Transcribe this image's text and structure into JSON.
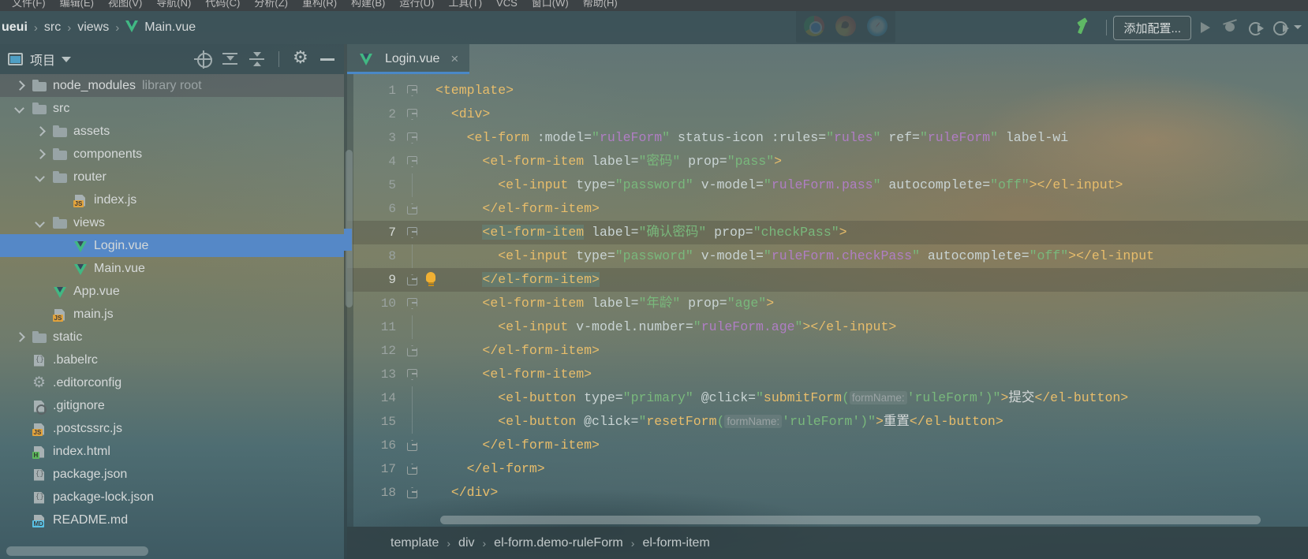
{
  "menubar": {
    "items": [
      "文件(F)",
      "编辑(E)",
      "视图(V)",
      "导航(N)",
      "代码(C)",
      "分析(Z)",
      "重构(R)",
      "构建(B)",
      "运行(U)",
      "工具(T)",
      "VCS",
      "窗口(W)",
      "帮助(H)"
    ]
  },
  "navbar": {
    "crumbs": [
      "ueui",
      "src",
      "views",
      "Main.vue"
    ],
    "separator": "›",
    "add_configuration_label": "添加配置...",
    "icons": [
      "hammer-build-icon",
      "run-icon",
      "debug-icon",
      "coverage-icon",
      "profile-icon",
      "chevron-down-icon"
    ]
  },
  "project_panel": {
    "title": "项目",
    "toolbar_icons": [
      "locate-icon",
      "expand-all-icon",
      "collapse-all-icon",
      "settings-gear-icon",
      "minimize-icon"
    ],
    "tree": [
      {
        "label": "node_modules",
        "suffix": "library root",
        "icon": "folder",
        "arrow": "right",
        "indent": 0,
        "state": "hover"
      },
      {
        "label": "src",
        "suffix": "",
        "icon": "folder",
        "arrow": "down",
        "indent": 0,
        "state": "normal"
      },
      {
        "label": "assets",
        "suffix": "",
        "icon": "folder",
        "arrow": "right",
        "indent": 1,
        "state": "normal"
      },
      {
        "label": "components",
        "suffix": "",
        "icon": "folder",
        "arrow": "right",
        "indent": 1,
        "state": "normal"
      },
      {
        "label": "router",
        "suffix": "",
        "icon": "folder",
        "arrow": "down",
        "indent": 1,
        "state": "normal"
      },
      {
        "label": "index.js",
        "suffix": "",
        "icon": "js",
        "arrow": "none",
        "indent": 2,
        "state": "normal"
      },
      {
        "label": "views",
        "suffix": "",
        "icon": "folder",
        "arrow": "down",
        "indent": 1,
        "state": "normal"
      },
      {
        "label": "Login.vue",
        "suffix": "",
        "icon": "vue",
        "arrow": "none",
        "indent": 2,
        "state": "selected"
      },
      {
        "label": "Main.vue",
        "suffix": "",
        "icon": "vue",
        "arrow": "none",
        "indent": 2,
        "state": "normal"
      },
      {
        "label": "App.vue",
        "suffix": "",
        "icon": "vue",
        "arrow": "none",
        "indent": 1,
        "state": "normal"
      },
      {
        "label": "main.js",
        "suffix": "",
        "icon": "js",
        "arrow": "none",
        "indent": 1,
        "state": "normal"
      },
      {
        "label": "static",
        "suffix": "",
        "icon": "folder",
        "arrow": "right",
        "indent": 0,
        "state": "normal"
      },
      {
        "label": ".babelrc",
        "suffix": "",
        "icon": "json",
        "arrow": "none",
        "indent": 0,
        "state": "normal"
      },
      {
        "label": ".editorconfig",
        "suffix": "",
        "icon": "cog",
        "arrow": "none",
        "indent": 0,
        "state": "normal"
      },
      {
        "label": ".gitignore",
        "suffix": "",
        "icon": "ban",
        "arrow": "none",
        "indent": 0,
        "state": "normal"
      },
      {
        "label": ".postcssrc.js",
        "suffix": "",
        "icon": "js",
        "arrow": "none",
        "indent": 0,
        "state": "normal"
      },
      {
        "label": "index.html",
        "suffix": "",
        "icon": "html",
        "arrow": "none",
        "indent": 0,
        "state": "normal"
      },
      {
        "label": "package.json",
        "suffix": "",
        "icon": "json",
        "arrow": "none",
        "indent": 0,
        "state": "normal"
      },
      {
        "label": "package-lock.json",
        "suffix": "",
        "icon": "json",
        "arrow": "none",
        "indent": 0,
        "state": "normal"
      },
      {
        "label": "README.md",
        "suffix": "",
        "icon": "md",
        "arrow": "none",
        "indent": 0,
        "state": "normal"
      }
    ]
  },
  "editor": {
    "tab": {
      "label": "Login.vue",
      "close": "×",
      "icon": "vue-file-icon"
    },
    "current_line": 9,
    "lines": [
      {
        "n": 1,
        "fold": "down",
        "tokens": [
          {
            "t": "tag",
            "v": "<template>"
          }
        ]
      },
      {
        "n": 2,
        "fold": "down",
        "tokens": [
          {
            "t": "plain",
            "v": "  "
          },
          {
            "t": "tag",
            "v": "<div>"
          }
        ]
      },
      {
        "n": 3,
        "fold": "down",
        "tokens": [
          {
            "t": "plain",
            "v": "    "
          },
          {
            "t": "tag",
            "v": "<el-form"
          },
          {
            "t": "plain",
            "v": " "
          },
          {
            "t": "attr",
            "v": ":model="
          },
          {
            "t": "str",
            "v": "\""
          },
          {
            "t": "prop",
            "v": "ruleForm"
          },
          {
            "t": "str",
            "v": "\""
          },
          {
            "t": "attr",
            "v": " status-icon :rules="
          },
          {
            "t": "str",
            "v": "\""
          },
          {
            "t": "prop",
            "v": "rules"
          },
          {
            "t": "str",
            "v": "\""
          },
          {
            "t": "attr",
            "v": " ref="
          },
          {
            "t": "str",
            "v": "\""
          },
          {
            "t": "prop",
            "v": "ruleForm"
          },
          {
            "t": "str",
            "v": "\""
          },
          {
            "t": "attr",
            "v": " label-wi"
          }
        ]
      },
      {
        "n": 4,
        "fold": "down",
        "tokens": [
          {
            "t": "plain",
            "v": "      "
          },
          {
            "t": "tag",
            "v": "<el-form-item"
          },
          {
            "t": "attr",
            "v": " label="
          },
          {
            "t": "str",
            "v": "\"密码\""
          },
          {
            "t": "attr",
            "v": " prop="
          },
          {
            "t": "str",
            "v": "\"pass\""
          },
          {
            "t": "tag",
            "v": ">"
          }
        ]
      },
      {
        "n": 5,
        "fold": "none",
        "tokens": [
          {
            "t": "plain",
            "v": "        "
          },
          {
            "t": "tag",
            "v": "<el-input"
          },
          {
            "t": "attr",
            "v": " type="
          },
          {
            "t": "str",
            "v": "\"password\""
          },
          {
            "t": "attr",
            "v": " v-model="
          },
          {
            "t": "str",
            "v": "\""
          },
          {
            "t": "prop",
            "v": "ruleForm.pass"
          },
          {
            "t": "str",
            "v": "\""
          },
          {
            "t": "attr",
            "v": " autocomplete="
          },
          {
            "t": "str",
            "v": "\"off\""
          },
          {
            "t": "tag",
            "v": "></el-input>"
          }
        ]
      },
      {
        "n": 6,
        "fold": "up",
        "tokens": [
          {
            "t": "plain",
            "v": "      "
          },
          {
            "t": "tag",
            "v": "</el-form-item>"
          }
        ]
      },
      {
        "n": 7,
        "fold": "down",
        "hl": true,
        "tokens": [
          {
            "t": "plain",
            "v": "      "
          },
          {
            "t": "tagbox",
            "v": "<el-form-item"
          },
          {
            "t": "attr",
            "v": " label="
          },
          {
            "t": "str",
            "v": "\"确认密码\""
          },
          {
            "t": "attr",
            "v": " prop="
          },
          {
            "t": "str",
            "v": "\"checkPass\""
          },
          {
            "t": "tag",
            "v": ">"
          }
        ]
      },
      {
        "n": 8,
        "fold": "none",
        "tokens": [
          {
            "t": "plain",
            "v": "        "
          },
          {
            "t": "tag",
            "v": "<el-input"
          },
          {
            "t": "attr",
            "v": " type="
          },
          {
            "t": "str",
            "v": "\"password\""
          },
          {
            "t": "attr",
            "v": " v-model="
          },
          {
            "t": "str",
            "v": "\""
          },
          {
            "t": "prop",
            "v": "ruleForm.checkPass"
          },
          {
            "t": "str",
            "v": "\""
          },
          {
            "t": "attr",
            "v": " autocomplete="
          },
          {
            "t": "str",
            "v": "\"off\""
          },
          {
            "t": "tag",
            "v": "></el-input"
          }
        ]
      },
      {
        "n": 9,
        "fold": "up",
        "hl": true,
        "bulb": true,
        "tokens": [
          {
            "t": "plain",
            "v": "      "
          },
          {
            "t": "tagbox",
            "v": "</el-form-item>"
          }
        ]
      },
      {
        "n": 10,
        "fold": "down",
        "tokens": [
          {
            "t": "plain",
            "v": "      "
          },
          {
            "t": "tag",
            "v": "<el-form-item"
          },
          {
            "t": "attr",
            "v": " label="
          },
          {
            "t": "str",
            "v": "\"年龄\""
          },
          {
            "t": "attr",
            "v": " prop="
          },
          {
            "t": "str",
            "v": "\"age\""
          },
          {
            "t": "tag",
            "v": ">"
          }
        ]
      },
      {
        "n": 11,
        "fold": "none",
        "tokens": [
          {
            "t": "plain",
            "v": "        "
          },
          {
            "t": "tag",
            "v": "<el-input"
          },
          {
            "t": "attr",
            "v": " v-model.number="
          },
          {
            "t": "str",
            "v": "\""
          },
          {
            "t": "prop",
            "v": "ruleForm.age"
          },
          {
            "t": "str",
            "v": "\""
          },
          {
            "t": "tag",
            "v": "></el-input>"
          }
        ]
      },
      {
        "n": 12,
        "fold": "up",
        "tokens": [
          {
            "t": "plain",
            "v": "      "
          },
          {
            "t": "tag",
            "v": "</el-form-item>"
          }
        ]
      },
      {
        "n": 13,
        "fold": "down",
        "tokens": [
          {
            "t": "plain",
            "v": "      "
          },
          {
            "t": "tag",
            "v": "<el-form-item>"
          }
        ]
      },
      {
        "n": 14,
        "fold": "none",
        "tokens": [
          {
            "t": "plain",
            "v": "        "
          },
          {
            "t": "tag",
            "v": "<el-button"
          },
          {
            "t": "attr",
            "v": " type="
          },
          {
            "t": "str",
            "v": "\"primary\""
          },
          {
            "t": "attr",
            "v": " @click="
          },
          {
            "t": "str",
            "v": "\""
          },
          {
            "t": "fn",
            "v": "submitForm"
          },
          {
            "t": "str",
            "v": "("
          },
          {
            "t": "hint",
            "v": "formName:"
          },
          {
            "t": "str",
            "v": "'ruleForm')\""
          },
          {
            "t": "tag",
            "v": ">"
          },
          {
            "t": "plain",
            "v": "提交"
          },
          {
            "t": "tag",
            "v": "</el-button>"
          }
        ]
      },
      {
        "n": 15,
        "fold": "none",
        "tokens": [
          {
            "t": "plain",
            "v": "        "
          },
          {
            "t": "tag",
            "v": "<el-button"
          },
          {
            "t": "attr",
            "v": " @click="
          },
          {
            "t": "str",
            "v": "\""
          },
          {
            "t": "fn",
            "v": "resetForm"
          },
          {
            "t": "str",
            "v": "("
          },
          {
            "t": "hint",
            "v": "formName:"
          },
          {
            "t": "str",
            "v": "'ruleForm')\""
          },
          {
            "t": "tag",
            "v": ">"
          },
          {
            "t": "plain",
            "v": "重置"
          },
          {
            "t": "tag",
            "v": "</el-button>"
          }
        ]
      },
      {
        "n": 16,
        "fold": "up",
        "tokens": [
          {
            "t": "plain",
            "v": "      "
          },
          {
            "t": "tag",
            "v": "</el-form-item>"
          }
        ]
      },
      {
        "n": 17,
        "fold": "up",
        "tokens": [
          {
            "t": "plain",
            "v": "    "
          },
          {
            "t": "tag",
            "v": "</el-form>"
          }
        ]
      },
      {
        "n": 18,
        "fold": "up",
        "tokens": [
          {
            "t": "plain",
            "v": "  "
          },
          {
            "t": "tag",
            "v": "</div>"
          }
        ]
      }
    ],
    "bottom_breadcrumb": [
      "template",
      "div",
      "el-form.demo-ruleForm",
      "el-form-item"
    ],
    "bottom_breadcrumb_sep": "›"
  },
  "browser_popup": {
    "browsers": [
      "chrome-icon",
      "firefox-icon",
      "safari-icon"
    ]
  }
}
